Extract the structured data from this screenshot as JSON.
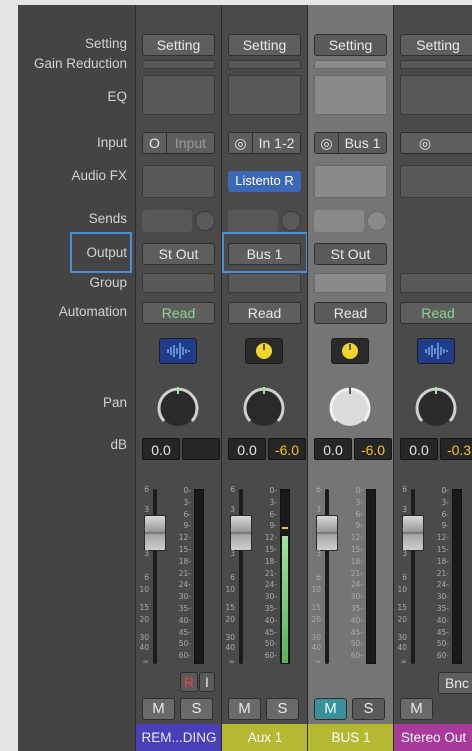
{
  "labels": {
    "setting": "Setting",
    "gain_reduction": "Gain Reduction",
    "eq": "EQ",
    "input": "Input",
    "audio_fx": "Audio FX",
    "sends": "Sends",
    "output": "Output",
    "group": "Group",
    "automation": "Automation",
    "pan": "Pan",
    "db": "dB"
  },
  "channels": [
    {
      "setting": "Setting",
      "input_icon": "O",
      "input": "Input",
      "audio_fx": "",
      "output": "St Out",
      "automation": "Read",
      "icon": "waveform-icon",
      "volume": "0.0",
      "peak": "",
      "mute": "M",
      "solo": "S",
      "record": "R",
      "input_monitor": "I",
      "name": "REM...DING",
      "name_color": "#4a3fb8",
      "name_text_color": "#e8e8ff"
    },
    {
      "setting": "Setting",
      "input_icon": "◎",
      "input": "In 1-2",
      "audio_fx": "Listento R",
      "output": "Bus 1",
      "automation": "Read",
      "icon": "power-knob-icon",
      "volume": "0.0",
      "peak": "-6.0",
      "mute": "M",
      "solo": "S",
      "name": "Aux 1",
      "name_color": "#b5b831",
      "name_text_color": "#ffffff"
    },
    {
      "setting": "Setting",
      "input_icon": "◎",
      "input": "Bus 1",
      "audio_fx": "",
      "output": "St Out",
      "automation": "Read",
      "icon": "power-knob-icon",
      "volume": "0.0",
      "peak": "-6.0",
      "mute": "M",
      "solo": "S",
      "name": "BUS 1",
      "name_color": "#b5b831",
      "name_text_color": "#ffffff"
    },
    {
      "setting": "Setting",
      "input_icon": "◎",
      "input": "",
      "audio_fx": "",
      "output": "",
      "automation": "Read",
      "icon": "waveform-icon",
      "volume": "0.0",
      "peak": "-0.3",
      "mute": "M",
      "solo": "",
      "bounce": "Bnc",
      "name": "Stereo Out",
      "name_color": "#a83a9c",
      "name_text_color": "#ffffff"
    }
  ],
  "fader_scale": [
    "6",
    "3",
    "0",
    "3",
    "6",
    "10",
    "15",
    "20",
    "30",
    "40",
    "∞"
  ],
  "meter_scale": [
    "0",
    "3",
    "6",
    "9",
    "12",
    "15",
    "18",
    "21",
    "24",
    "30",
    "35",
    "40",
    "45",
    "50",
    "60"
  ],
  "meter_levels": [
    0,
    0.63,
    0,
    0
  ],
  "colors": {
    "selection": "#4c8fd4",
    "automation_read": "#8fd18f",
    "peak_yellow": "#f0c419",
    "peak_green": "#7ed07e"
  }
}
